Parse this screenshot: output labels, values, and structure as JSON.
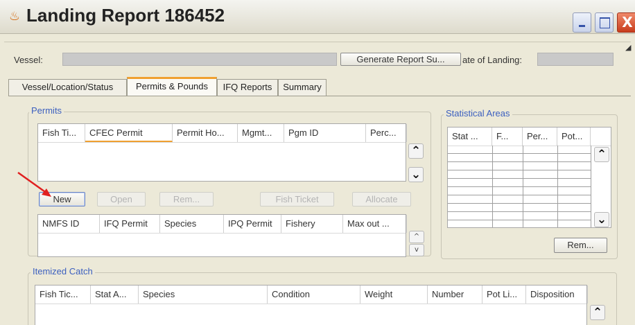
{
  "window": {
    "title": "Landing Report 186452",
    "icon": "java-cup-icon",
    "close_glyph": "X"
  },
  "header": {
    "vessel_label": "Vessel:",
    "generate_button": "Generate Report Su...",
    "date_label": "ate of Landing:"
  },
  "tabs": [
    {
      "label": "Vessel/Location/Status"
    },
    {
      "label": "Permits & Pounds"
    },
    {
      "label": "IFQ Reports"
    },
    {
      "label": "Summary"
    }
  ],
  "permits": {
    "group_title": "Permits",
    "columns": [
      "Fish Ti...",
      "CFEC Permit",
      "Permit Ho...",
      "Mgmt...",
      "Pgm ID",
      "Perc..."
    ],
    "buttons": {
      "new": "New",
      "open": "Open",
      "remove": "Rem...",
      "fish_ticket": "Fish Ticket",
      "allocate": "Allocate"
    },
    "ifq_columns": [
      "NMFS ID",
      "IFQ Permit",
      "Species",
      "IPQ Permit",
      "Fishery",
      "Max out ..."
    ]
  },
  "stat_areas": {
    "group_title": "Statistical Areas",
    "columns": [
      "Stat ...",
      "F...",
      "Per...",
      "Pot..."
    ],
    "remove_button": "Rem..."
  },
  "itemized": {
    "group_title": "Itemized Catch",
    "columns": [
      "Fish Tic...",
      "Stat A...",
      "Species",
      "Condition",
      "Weight",
      "Number",
      "Pot Li...",
      "Disposition"
    ]
  },
  "glyphs": {
    "up": "⌃",
    "down": "⌄",
    "small_up": "^",
    "small_down": "v"
  },
  "colors": {
    "background": "#3a2f9e",
    "accent_orange": "#f0a030",
    "group_title_blue": "#3b5fbf",
    "annotation_red": "#e02020"
  }
}
